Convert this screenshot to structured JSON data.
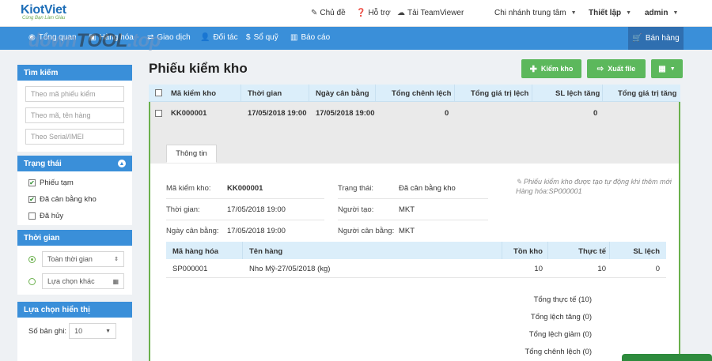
{
  "header": {
    "logo_main": "KiotViet",
    "logo_sub": "Cùng Bạn Làm Giàu",
    "links": {
      "theme": "Chủ đề",
      "support": "Hỗ trợ",
      "teamviewer": "Tải TeamViewer",
      "branch": "Chi nhánh trung tâm",
      "settings": "Thiết lập",
      "user": "admin"
    }
  },
  "nav": {
    "overview": "Tổng quan",
    "products": "Hàng hóa",
    "transactions": "Giao dịch",
    "partners": "Đối tác",
    "cashbook": "Sổ quỹ",
    "reports": "Báo cáo",
    "sale": "Bán hàng"
  },
  "watermark": {
    "part1": "down",
    "part2": "TOOL",
    "part3": ".top"
  },
  "sidebar": {
    "search": {
      "title": "Tìm kiếm",
      "placeholders": [
        "Theo mã phiếu kiểm",
        "Theo mã, tên hàng",
        "Theo Serial/IMEI"
      ]
    },
    "status": {
      "title": "Trạng thái",
      "options": [
        {
          "label": "Phiếu tạm",
          "checked": true
        },
        {
          "label": "Đã cân bằng kho",
          "checked": true
        },
        {
          "label": "Đã hủy",
          "checked": false
        }
      ]
    },
    "time": {
      "title": "Thời gian",
      "option1": "Toàn thời gian",
      "option2": "Lựa chọn khác"
    },
    "display": {
      "title": "Lựa chọn hiển thị",
      "records_label": "Số bản ghi:",
      "records_value": "10"
    }
  },
  "main": {
    "title": "Phiếu kiểm kho",
    "buttons": {
      "add": "Kiểm kho",
      "export": "Xuất file"
    },
    "columns": [
      "Mã kiểm kho",
      "Thời gian",
      "Ngày cân bằng",
      "Tổng chênh lệch",
      "Tổng giá trị lệch",
      "SL lệch tăng",
      "Tổng giá trị tăng"
    ],
    "row": {
      "code": "KK000001",
      "time": "17/05/2018 19:00",
      "balance_date": "17/05/2018 19:00",
      "total_diff": "0",
      "sl_increase": "0"
    },
    "detail": {
      "tab": "Thông tin",
      "code_label": "Mã kiểm kho:",
      "code_value": "KK000001",
      "time_label": "Thời gian:",
      "time_value": "17/05/2018 19:00",
      "balance_label": "Ngày cân bằng:",
      "balance_value": "17/05/2018 19:00",
      "status_label": "Trạng thái:",
      "status_value": "Đã cân bằng kho",
      "creator_label": "Người tạo:",
      "creator_value": "MKT",
      "balancer_label": "Người cân bằng:",
      "balancer_value": "MKT",
      "note": "Phiếu kiểm kho được tạo tự động khi thêm mới Hàng hóa:SP000001",
      "items_columns": [
        "Mã hàng hóa",
        "Tên hàng",
        "Tồn kho",
        "Thực tế",
        "SL lệch"
      ],
      "items": [
        {
          "code": "SP000001",
          "name": "Nho Mỹ-27/05/2018 (kg)",
          "stock": "10",
          "actual": "10",
          "diff": "0"
        }
      ],
      "summary": {
        "actual": "Tổng thực tế (10)",
        "increase": "Tổng lệch tăng (0)",
        "decrease": "Tổng lệch giảm (0)",
        "diff": "Tổng chênh lệch (0)"
      }
    }
  },
  "colors": {
    "primary": "#3a8fd9",
    "green": "#5cb85c",
    "header_row": "#dbeefa"
  }
}
